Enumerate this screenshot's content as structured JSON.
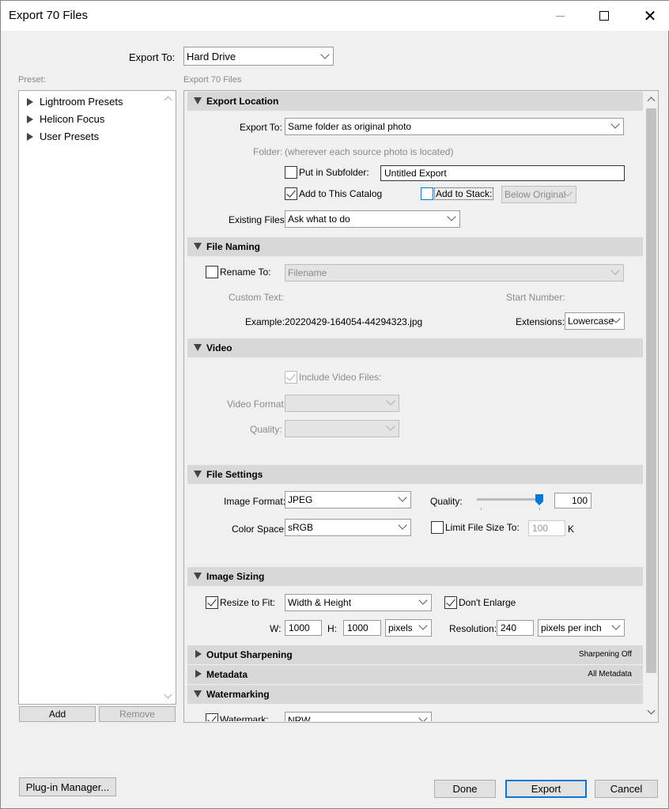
{
  "window": {
    "title": "Export 70 Files"
  },
  "export_to": {
    "label": "Export To:",
    "value": "Hard Drive"
  },
  "preset": {
    "label": "Preset:",
    "items": [
      {
        "label": "Lightroom Presets"
      },
      {
        "label": "Helicon Focus"
      },
      {
        "label": "User Presets"
      }
    ],
    "add_label": "Add",
    "remove_label": "Remove"
  },
  "panel_header": "Export 70 Files",
  "sections": {
    "export_location": {
      "title": "Export Location",
      "export_to_label": "Export To:",
      "export_to_value": "Same folder as original photo",
      "folder_label": "Folder:",
      "folder_value": "(wherever each source photo is located)",
      "subfolder_label": "Put in Subfolder:",
      "subfolder_value": "Untitled Export",
      "add_catalog_label": "Add to This Catalog",
      "add_stack_label": "Add to Stack:",
      "stack_position": "Below Original",
      "existing_files_label": "Existing Files:",
      "existing_files_value": "Ask what to do"
    },
    "file_naming": {
      "title": "File Naming",
      "rename_label": "Rename To:",
      "rename_value": "Filename",
      "custom_text_label": "Custom Text:",
      "start_number_label": "Start Number:",
      "example_label": "Example:",
      "example_value": "20220429-164054-44294323.jpg",
      "extensions_label": "Extensions:",
      "extensions_value": "Lowercase"
    },
    "video": {
      "title": "Video",
      "include_label": "Include Video Files:",
      "format_label": "Video Format:",
      "quality_label": "Quality:"
    },
    "file_settings": {
      "title": "File Settings",
      "image_format_label": "Image Format:",
      "image_format_value": "JPEG",
      "quality_label": "Quality:",
      "quality_value": "100",
      "quality_fraction": 1.0,
      "color_space_label": "Color Space:",
      "color_space_value": "sRGB",
      "limit_label": "Limit File Size To:",
      "limit_value": "100",
      "limit_unit": "K"
    },
    "image_sizing": {
      "title": "Image Sizing",
      "resize_label": "Resize to Fit:",
      "resize_value": "Width & Height",
      "dont_enlarge_label": "Don't Enlarge",
      "w_label": "W:",
      "w_value": "1000",
      "h_label": "H:",
      "h_value": "1000",
      "unit_value": "pixels",
      "resolution_label": "Resolution:",
      "resolution_value": "240",
      "resolution_unit": "pixels per inch"
    },
    "output_sharpening": {
      "title": "Output Sharpening",
      "summary": "Sharpening Off"
    },
    "metadata": {
      "title": "Metadata",
      "summary": "All Metadata"
    },
    "watermarking": {
      "title": "Watermarking",
      "watermark_label": "Watermark:",
      "watermark_value": "NRW"
    }
  },
  "footer": {
    "plugin_manager": "Plug-in Manager...",
    "done": "Done",
    "export": "Export",
    "cancel": "Cancel"
  },
  "colors": {
    "accent": "#0078d7",
    "section_bg": "#d8d8d8",
    "window_bg": "#f0f0f0"
  }
}
